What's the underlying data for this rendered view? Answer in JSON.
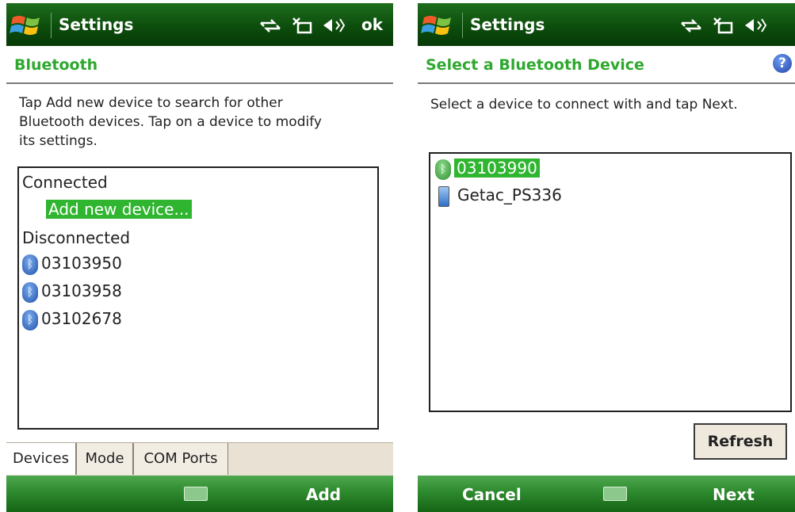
{
  "left": {
    "title": "Settings",
    "ok": "ok",
    "header": "Bluetooth",
    "instructions": [
      "Tap Add new device to search for other",
      "Bluetooth devices. Tap on a device to modify",
      "its settings."
    ],
    "list": {
      "connected": "Connected",
      "add_new": "Add new device...",
      "disconnected": "Disconnected",
      "devices": [
        "03103950",
        "03103958",
        "03102678"
      ]
    },
    "tabs": [
      "Devices",
      "Mode",
      "COM Ports"
    ],
    "softkey_right": "Add"
  },
  "right": {
    "title": "Settings",
    "header": "Select a Bluetooth Device",
    "help": "?",
    "instruction": "Select a device to connect with and tap Next.",
    "devices": [
      "03103990",
      "Getac_PS336"
    ],
    "refresh": "Refresh",
    "softkey_left": "Cancel",
    "softkey_right": "Next"
  },
  "colors": {
    "titlebar": "#0c4d0c",
    "accent": "#2ea82e",
    "selection": "#2fb52f"
  },
  "icons": [
    "windows-start-icon",
    "connectivity-icon",
    "signal-off-icon",
    "volume-icon",
    "bluetooth-icon",
    "keyboard-icon",
    "help-icon"
  ]
}
